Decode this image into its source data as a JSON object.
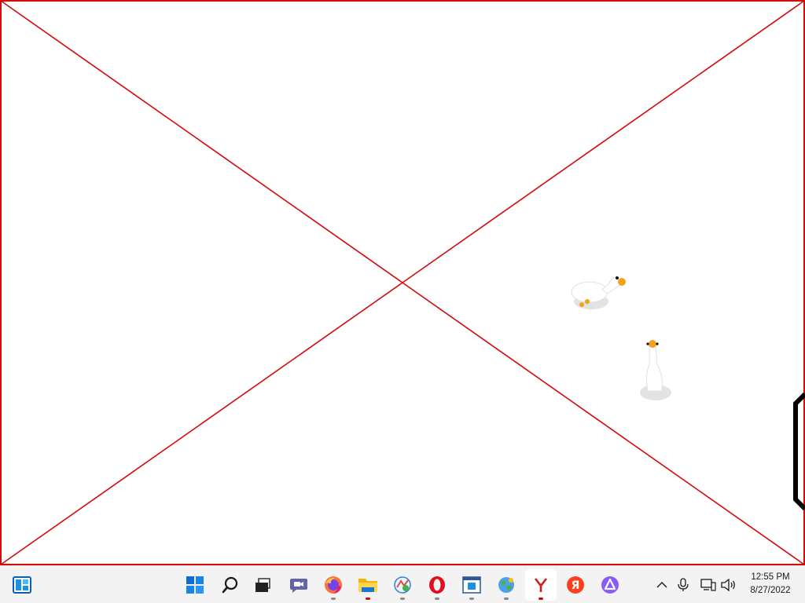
{
  "desktop": {
    "content": "broken-image-placeholder",
    "colors": {
      "cross_lines": "#d40a0a",
      "background": "#ffffff"
    },
    "sprites": [
      "goose-walking-icon",
      "goose-standing-icon"
    ]
  },
  "taskbar": {
    "left": [
      {
        "name": "widgets-button",
        "icon": "widgets-icon"
      }
    ],
    "center": [
      {
        "name": "start-button",
        "icon": "windows-logo-icon",
        "running": false
      },
      {
        "name": "search-button",
        "icon": "search-icon",
        "running": false
      },
      {
        "name": "task-view-button",
        "icon": "task-view-icon",
        "running": false
      },
      {
        "name": "chat-button",
        "icon": "teams-chat-icon",
        "running": false
      },
      {
        "name": "firefox-button",
        "icon": "firefox-icon",
        "running": true
      },
      {
        "name": "file-explorer-button",
        "icon": "folder-icon",
        "running": true,
        "indicator": "red"
      },
      {
        "name": "app-button-1",
        "icon": "colorful-app-icon",
        "running": true
      },
      {
        "name": "opera-button",
        "icon": "opera-icon",
        "running": true
      },
      {
        "name": "app-window-button",
        "icon": "app-window-icon",
        "running": true
      },
      {
        "name": "app-globe-button",
        "icon": "globe-app-icon",
        "running": true
      },
      {
        "name": "yandex-browser-button",
        "icon": "yandex-browser-icon",
        "running": true,
        "active": true,
        "indicator": "red"
      },
      {
        "name": "yandex-button",
        "icon": "yandex-icon",
        "running": false
      },
      {
        "name": "alice-button",
        "icon": "alice-assistant-icon",
        "running": false
      }
    ],
    "tray": [
      {
        "name": "show-hidden-icons-button",
        "icon": "chevron-up-icon"
      },
      {
        "name": "microphone-button",
        "icon": "microphone-icon"
      },
      {
        "name": "network-button",
        "icon": "network-icon"
      },
      {
        "name": "volume-button",
        "icon": "speaker-icon"
      }
    ],
    "clock": {
      "time": "12:55 PM",
      "date": "8/27/2022"
    }
  }
}
